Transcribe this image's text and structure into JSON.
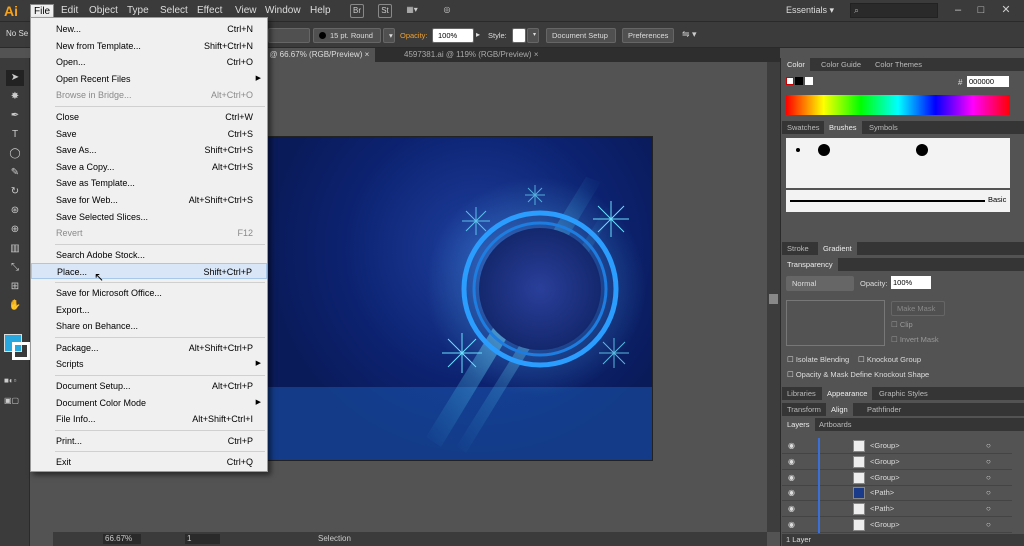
{
  "app": {
    "logo": "Ai"
  },
  "menubar": {
    "items": [
      "File",
      "Edit",
      "Object",
      "Type",
      "Select",
      "Effect",
      "View",
      "Window",
      "Help"
    ],
    "workspace": "Essentials"
  },
  "control_bar": {
    "selection_label": "No Se",
    "brush_label": "15 pt. Round",
    "opacity_label": "Opacity:",
    "opacity_value": "100%",
    "style_label": "Style:",
    "document_setup": "Document Setup",
    "preferences": "Preferences"
  },
  "tabs": [
    {
      "label": "* @ 66.67% (RGB/Preview)",
      "close": "×"
    },
    {
      "label": "4597381.ai @ 119% (RGB/Preview)",
      "close": "×"
    }
  ],
  "file_menu": [
    {
      "label": "New...",
      "shortcut": "Ctrl+N"
    },
    {
      "label": "New from Template...",
      "shortcut": "Shift+Ctrl+N"
    },
    {
      "label": "Open...",
      "shortcut": "Ctrl+O"
    },
    {
      "label": "Open Recent Files",
      "shortcut": "",
      "submenu": true
    },
    {
      "label": "Browse in Bridge...",
      "shortcut": "Alt+Ctrl+O",
      "disabled": true
    },
    {
      "sep": true
    },
    {
      "label": "Close",
      "shortcut": "Ctrl+W"
    },
    {
      "label": "Save",
      "shortcut": "Ctrl+S"
    },
    {
      "label": "Save As...",
      "shortcut": "Shift+Ctrl+S"
    },
    {
      "label": "Save a Copy...",
      "shortcut": "Alt+Ctrl+S"
    },
    {
      "label": "Save as Template...",
      "shortcut": ""
    },
    {
      "label": "Save for Web...",
      "shortcut": "Alt+Shift+Ctrl+S"
    },
    {
      "label": "Save Selected Slices...",
      "shortcut": ""
    },
    {
      "label": "Revert",
      "shortcut": "F12",
      "disabled": true
    },
    {
      "sep": true
    },
    {
      "label": "Search Adobe Stock...",
      "shortcut": ""
    },
    {
      "label": "Place...",
      "shortcut": "Shift+Ctrl+P",
      "highlighted": true
    },
    {
      "sep": true
    },
    {
      "label": "Save for Microsoft Office...",
      "shortcut": ""
    },
    {
      "label": "Export...",
      "shortcut": ""
    },
    {
      "label": "Share on Behance...",
      "shortcut": ""
    },
    {
      "sep": true
    },
    {
      "label": "Package...",
      "shortcut": "Alt+Shift+Ctrl+P"
    },
    {
      "label": "Scripts",
      "shortcut": "",
      "submenu": true
    },
    {
      "sep": true
    },
    {
      "label": "Document Setup...",
      "shortcut": "Alt+Ctrl+P"
    },
    {
      "label": "Document Color Mode",
      "shortcut": "",
      "submenu": true
    },
    {
      "label": "File Info...",
      "shortcut": "Alt+Shift+Ctrl+I"
    },
    {
      "sep": true
    },
    {
      "label": "Print...",
      "shortcut": "Ctrl+P"
    },
    {
      "sep": true
    },
    {
      "label": "Exit",
      "shortcut": "Ctrl+Q"
    }
  ],
  "panels": {
    "color_tabs": [
      "Color",
      "Color Guide",
      "Color Themes"
    ],
    "hex_label": "#",
    "hex_value": "000000",
    "swatch_tabs": [
      "Swatches",
      "Brushes",
      "Symbols"
    ],
    "brush_basic": "Basic",
    "stroke_tabs": [
      "Stroke",
      "Gradient"
    ],
    "transparency_tab": "Transparency",
    "blend_mode": "Normal",
    "opacity_label": "Opacity:",
    "opacity_value": "100%",
    "make_mask": "Make Mask",
    "clip": "Clip",
    "invert_mask": "Invert Mask",
    "isolate_blending": "Isolate Blending",
    "knockout_group": "Knockout Group",
    "opacity_mask": "Opacity & Mask Define Knockout Shape",
    "lib_tabs": [
      "Libraries",
      "Appearance",
      "Graphic Styles"
    ],
    "align_tabs": [
      "Transform",
      "Align",
      "Pathfinder"
    ],
    "layer_tabs": [
      "Layers",
      "Artboards"
    ],
    "layers": [
      "<Group>",
      "<Group>",
      "<Group>",
      "<Path>",
      "<Path>",
      "<Group>"
    ],
    "layers_count": "1 Layer"
  },
  "status": {
    "zoom": "66.67%",
    "artboard_num": "1",
    "tool": "Selection"
  }
}
